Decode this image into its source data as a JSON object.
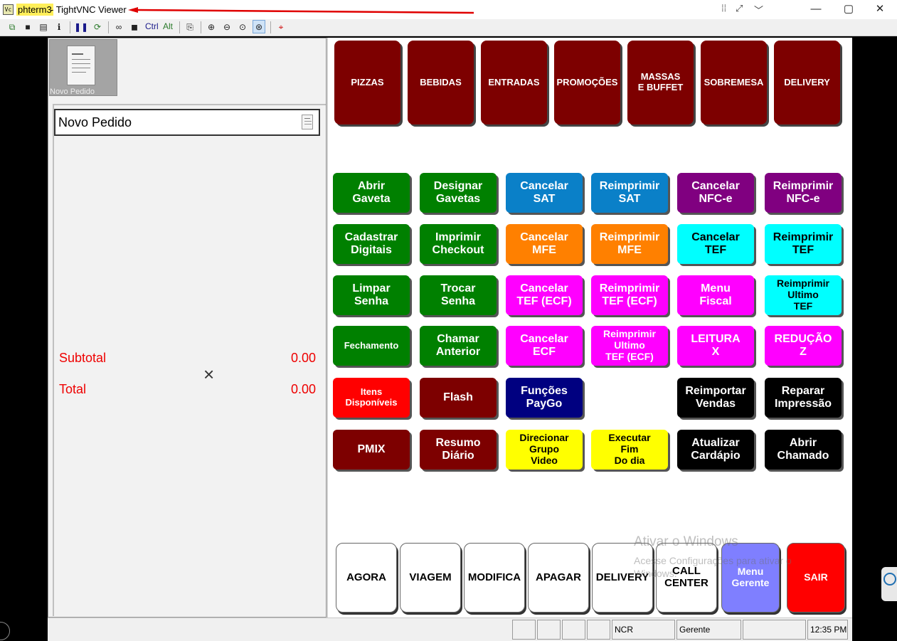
{
  "window": {
    "icon_text": "Vc",
    "host": "phterm3",
    "app_title": " - TightVNC Viewer",
    "extra_icons": [
      "grip-icon",
      "expand-icon",
      "chevron-down-icon"
    ],
    "controls": [
      "minimize",
      "maximize",
      "close"
    ]
  },
  "toolbar": {
    "ctrl_label": "Ctrl",
    "alt_label": "Alt"
  },
  "order_panel": {
    "thumbnail_label": "Novo Pedido",
    "title": "Novo Pedido",
    "subtotal_label": "Subtotal",
    "subtotal_value": "0.00",
    "total_label": "Total",
    "total_value": "0.00",
    "cursor_glyph": "×"
  },
  "categories": [
    {
      "label": "PIZZAS"
    },
    {
      "label": "BEBIDAS"
    },
    {
      "label": "ENTRADAS"
    },
    {
      "label": "PROMOÇÕES"
    },
    {
      "label": "MASSAS\nE BUFFET"
    },
    {
      "label": "SOBREMESA"
    },
    {
      "label": "DELIVERY"
    }
  ],
  "function_buttons": [
    {
      "label": "Abrir\nGaveta",
      "color": "#008000",
      "text_color": "#ffffff"
    },
    {
      "label": "Designar\nGavetas",
      "color": "#008000",
      "text_color": "#ffffff"
    },
    {
      "label": "Cancelar\nSAT",
      "color": "#0a80c8",
      "text_color": "#ffffff"
    },
    {
      "label": "Reimprimir\nSAT",
      "color": "#0a80c8",
      "text_color": "#ffffff"
    },
    {
      "label": "Cancelar\nNFC-e",
      "color": "#800080",
      "text_color": "#ffffff"
    },
    {
      "label": "Reimprimir\nNFC-e",
      "color": "#800080",
      "text_color": "#ffffff"
    },
    {
      "label": "Cadastrar\nDigitais",
      "color": "#008000",
      "text_color": "#ffffff"
    },
    {
      "label": "Imprimir\nCheckout",
      "color": "#008000",
      "text_color": "#ffffff"
    },
    {
      "label": "Cancelar\nMFE",
      "color": "#ff8000",
      "text_color": "#ffffff"
    },
    {
      "label": "Reimprimir\nMFE",
      "color": "#ff8000",
      "text_color": "#ffffff"
    },
    {
      "label": "Cancelar\nTEF",
      "color": "#00ffff",
      "text_color": "#000000"
    },
    {
      "label": "Reimprimir\nTEF",
      "color": "#00ffff",
      "text_color": "#000000"
    },
    {
      "label": "Limpar\nSenha",
      "color": "#008000",
      "text_color": "#ffffff"
    },
    {
      "label": "Trocar\nSenha",
      "color": "#008000",
      "text_color": "#ffffff"
    },
    {
      "label": "Cancelar\nTEF (ECF)",
      "color": "#ff00ff",
      "text_color": "#ffffff"
    },
    {
      "label": "Reimprimir\nTEF (ECF)",
      "color": "#ff00ff",
      "text_color": "#ffffff"
    },
    {
      "label": "Menu\nFiscal",
      "color": "#ff00ff",
      "text_color": "#ffffff"
    },
    {
      "label": "Reimprimir\nUltimo\nTEF",
      "color": "#00ffff",
      "text_color": "#000000"
    },
    {
      "label": "Fechamento",
      "color": "#008000",
      "text_color": "#ffffff",
      "small": true
    },
    {
      "label": "Chamar\nAnterior",
      "color": "#008000",
      "text_color": "#ffffff"
    },
    {
      "label": "Cancelar\nECF",
      "color": "#ff00ff",
      "text_color": "#ffffff"
    },
    {
      "label": "Reimprimir\nUltimo\nTEF (ECF)",
      "color": "#ff00ff",
      "text_color": "#ffffff"
    },
    {
      "label": "LEITURA\nX",
      "color": "#ff00ff",
      "text_color": "#ffffff"
    },
    {
      "label": "REDUÇÃO\nZ",
      "color": "#ff00ff",
      "text_color": "#ffffff"
    },
    {
      "label": "Itens\nDisponíveis",
      "color": "#ff0000",
      "text_color": "#ffffff",
      "small": true
    },
    {
      "label": "Flash",
      "color": "#7d0000",
      "text_color": "#ffffff"
    },
    {
      "label": "Funções\nPayGo",
      "color": "#000080",
      "text_color": "#ffffff"
    },
    null,
    {
      "label": "Reimportar\nVendas",
      "color": "#000000",
      "text_color": "#ffffff"
    },
    {
      "label": "Reparar\nImpressão",
      "color": "#000000",
      "text_color": "#ffffff"
    },
    {
      "label": "PMIX",
      "color": "#7d0000",
      "text_color": "#ffffff"
    },
    {
      "label": "Resumo\nDiário",
      "color": "#7d0000",
      "text_color": "#ffffff"
    },
    {
      "label": "Direcionar\nGrupo\nVideo",
      "color": "#ffff00",
      "text_color": "#000000"
    },
    {
      "label": "Executar\nFim\nDo dia",
      "color": "#ffff00",
      "text_color": "#000000",
      "small": true
    },
    {
      "label": "Atualizar\nCardápio",
      "color": "#000000",
      "text_color": "#ffffff"
    },
    {
      "label": "Abrir\nChamado",
      "color": "#000000",
      "text_color": "#ffffff"
    }
  ],
  "bottom_buttons": [
    {
      "label": "AGORA",
      "color": "#ffffff",
      "text_color": "#000000"
    },
    {
      "label": "VIAGEM",
      "color": "#ffffff",
      "text_color": "#000000"
    },
    {
      "label": "MODIFICA",
      "color": "#ffffff",
      "text_color": "#000000"
    },
    {
      "label": "APAGAR",
      "color": "#ffffff",
      "text_color": "#000000"
    },
    {
      "label": "DELIVERY",
      "color": "#ffffff",
      "text_color": "#000000"
    },
    {
      "label": "CALL\nCENTER",
      "color": "#ffffff",
      "text_color": "#000000"
    },
    {
      "label": "Menu\nGerente",
      "color": "#7f7fff",
      "text_color": "#ffffff"
    },
    {
      "label": "SAIR",
      "color": "#ff0000",
      "text_color": "#ffffff"
    }
  ],
  "status_bar": {
    "cells": [
      "",
      "",
      "",
      "",
      "NCR",
      "Gerente",
      "",
      "12:35 PM"
    ]
  },
  "watermark": {
    "line1": "Ativar o Windows",
    "line2": "Acesse Configurações para ativar o Windows."
  }
}
